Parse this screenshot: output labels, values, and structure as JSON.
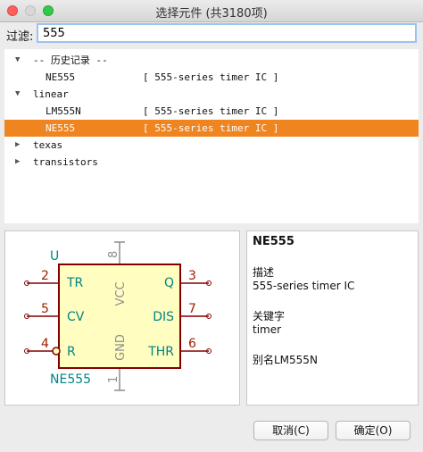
{
  "window": {
    "title": "选择元件 (共3180项)"
  },
  "filter": {
    "label": "过滤:",
    "value": "555"
  },
  "tree": {
    "rows": [
      {
        "name": "-- 历史记录 --",
        "desc": "",
        "arrow": "expanded",
        "indent": 0
      },
      {
        "name": "NE555",
        "desc": "[ 555-series timer IC ]",
        "arrow": "",
        "indent": 1
      },
      {
        "name": "linear",
        "desc": "",
        "arrow": "expanded",
        "indent": 0
      },
      {
        "name": "LM555N",
        "desc": "[ 555-series timer IC ]",
        "arrow": "",
        "indent": 1
      },
      {
        "name": "NE555",
        "desc": "[ 555-series timer IC ]",
        "arrow": "",
        "indent": 1,
        "selected": true
      },
      {
        "name": "texas",
        "desc": "",
        "arrow": "collapsed",
        "indent": 0
      },
      {
        "name": "transistors",
        "desc": "",
        "arrow": "collapsed",
        "indent": 0
      }
    ]
  },
  "symbol": {
    "ref": "U",
    "value": "NE555",
    "left_pins": [
      {
        "num": "2",
        "name": "TR"
      },
      {
        "num": "5",
        "name": "CV"
      },
      {
        "num": "4",
        "name": "R"
      }
    ],
    "right_pins": [
      {
        "num": "3",
        "name": "Q"
      },
      {
        "num": "7",
        "name": "DIS"
      },
      {
        "num": "6",
        "name": "THR"
      }
    ],
    "top_pin": {
      "num": "8",
      "name": "VCC"
    },
    "bottom_pin": {
      "num": "1",
      "name": "GND"
    },
    "colors": {
      "body_fill": "#fffdc0",
      "outline": "#840000",
      "pin_name": "#008484",
      "pin_num": "#a02000",
      "gray": "#8e8e8e"
    }
  },
  "info": {
    "name": "NE555",
    "desc_label": "描述",
    "desc_value": "555-series timer IC",
    "keywords_label": "关键字",
    "keywords_value": "timer",
    "alias": "别名LM555N"
  },
  "buttons": {
    "cancel": "取消(C)",
    "ok": "确定(O)"
  }
}
